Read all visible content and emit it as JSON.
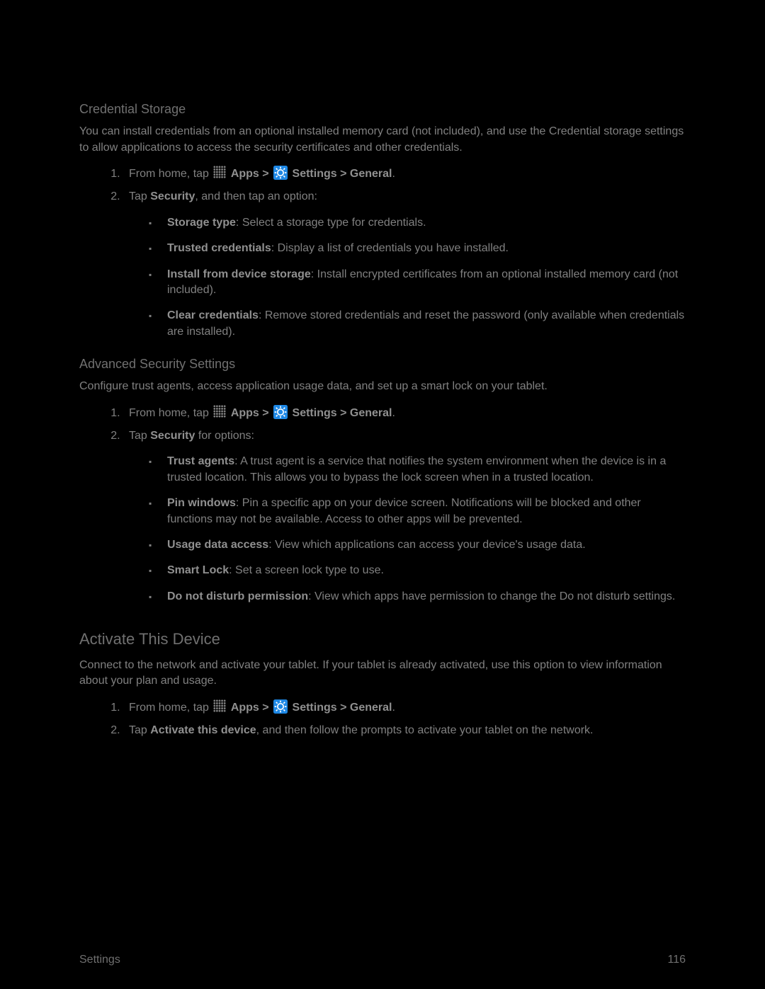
{
  "credential": {
    "heading": "Credential Storage",
    "intro": "You can install credentials from an optional installed memory card (not included), and use the Credential storage settings to allow applications to access the security certificates and other credentials.",
    "step1_prefix": "From home, tap ",
    "path_apps": "Apps",
    "gt": " > ",
    "path_settings_general": "Settings > General",
    "period": ".",
    "step2_prefix": "Tap ",
    "step2_bold": "Security",
    "step2_suffix": ", and then tap an option:",
    "items": [
      {
        "bold": "Storage type",
        "rest": ": Select a storage type for credentials."
      },
      {
        "bold": "Trusted credentials",
        "rest": ": Display a list of credentials you have installed."
      },
      {
        "bold": "Install from device storage",
        "rest": ": Install encrypted certificates from an optional installed memory card (not included)."
      },
      {
        "bold": "Clear credentials",
        "rest": ": Remove stored credentials and reset the password (only available when credentials are installed)."
      }
    ]
  },
  "advanced": {
    "heading": "Advanced Security Settings",
    "intro": "Configure trust agents, access application usage data, and set up a smart lock on your tablet.",
    "step2_prefix": "Tap ",
    "step2_bold": "Security",
    "step2_suffix": " for options:",
    "items": [
      {
        "bold": "Trust agents",
        "rest": ": A trust agent is a service that notifies the system environment when the device is in a trusted location. This allows you to bypass the lock screen when in a trusted location."
      },
      {
        "bold": "Pin windows",
        "rest": ": Pin a specific app on your device screen. Notifications will be blocked and other functions may not be available. Access to other apps will be prevented."
      },
      {
        "bold": "Usage data access",
        "rest": ": View which applications can access your device's usage data."
      },
      {
        "bold": "Smart Lock",
        "rest": ": Set a screen lock type to use."
      },
      {
        "bold": "Do not disturb permission",
        "rest": ": View which apps have permission to change the Do not disturb settings."
      }
    ]
  },
  "activate": {
    "heading": "Activate This Device",
    "intro": "Connect to the network and activate your tablet. If your tablet is already activated, use this option to view information about your plan and usage.",
    "step2_prefix": "Tap ",
    "step2_bold": "Activate this device",
    "step2_suffix": ", and then follow the prompts to activate your tablet on the network."
  },
  "footer": {
    "left": "Settings",
    "right": "116"
  }
}
